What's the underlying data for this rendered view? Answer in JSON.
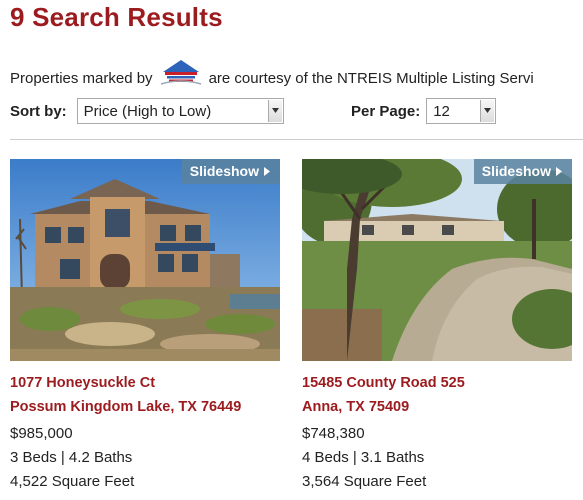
{
  "header": {
    "title": "9 Search Results"
  },
  "courtesy": {
    "prefix": "Properties marked by",
    "suffix": "are courtesy of the NTREIS Multiple Listing Servi",
    "logo_icon": "ntreis-house-logo"
  },
  "sort": {
    "label": "Sort by:",
    "value": "Price (High to Low)"
  },
  "per_page": {
    "label": "Per Page:",
    "value": "12"
  },
  "listings": [
    {
      "slideshow_label": "Slideshow",
      "street": "1077 Honeysuckle Ct",
      "city": "Possum Kingdom Lake, TX 76449",
      "price": "$985,000",
      "beds_baths": "3 Beds | 4.2 Baths",
      "sqft": "4,522 Square Feet"
    },
    {
      "slideshow_label": "Slideshow",
      "street": "15485 County Road 525",
      "city": "Anna, TX 75409",
      "price": "$748,380",
      "beds_baths": "4 Beds | 3.1 Baths",
      "sqft": "3,564 Square Feet"
    }
  ],
  "colors": {
    "accent": "#9b1b1e",
    "slideshow_bg": "#5a82a0"
  }
}
